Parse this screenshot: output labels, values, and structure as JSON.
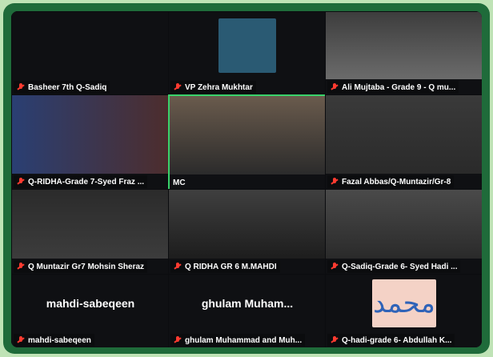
{
  "tiles": {
    "t1": {
      "name": "Basheer 7th Q-Sadiq"
    },
    "t2": {
      "name": "VP Zehra Mukhtar"
    },
    "t3": {
      "name": "Ali Mujtaba - Grade 9 - Q mu..."
    },
    "t4": {
      "name": "Q-RIDHA-Grade 7-Syed Fraz ..."
    },
    "t5": {
      "name": "MC"
    },
    "t6": {
      "name": "Fazal Abbas/Q-Muntazir/Gr-8"
    },
    "t7": {
      "name": "Q Muntazir Gr7 Mohsin Sheraz"
    },
    "t8": {
      "name": "Q RIDHA GR 6 M.MAHDI"
    },
    "t9": {
      "name": "Q-Sadiq-Grade 6- Syed Hadi ..."
    },
    "t10": {
      "center": "mahdi-sabeqeen",
      "name": "mahdi-sabeqeen"
    },
    "t11": {
      "center": "ghulam Muham...",
      "name": "ghulam Muhammad and Muh..."
    },
    "t12": {
      "name": "Q-hadi-grade 6- Abdullah K...",
      "image_text": "محمد"
    }
  },
  "colors": {
    "outer_background": "#bfe3b6",
    "frame": "#1f6b3a",
    "active_speaker_border": "#39d36b",
    "mic_muted": "#ff3b30"
  },
  "icons": [
    "mic-muted-icon"
  ]
}
